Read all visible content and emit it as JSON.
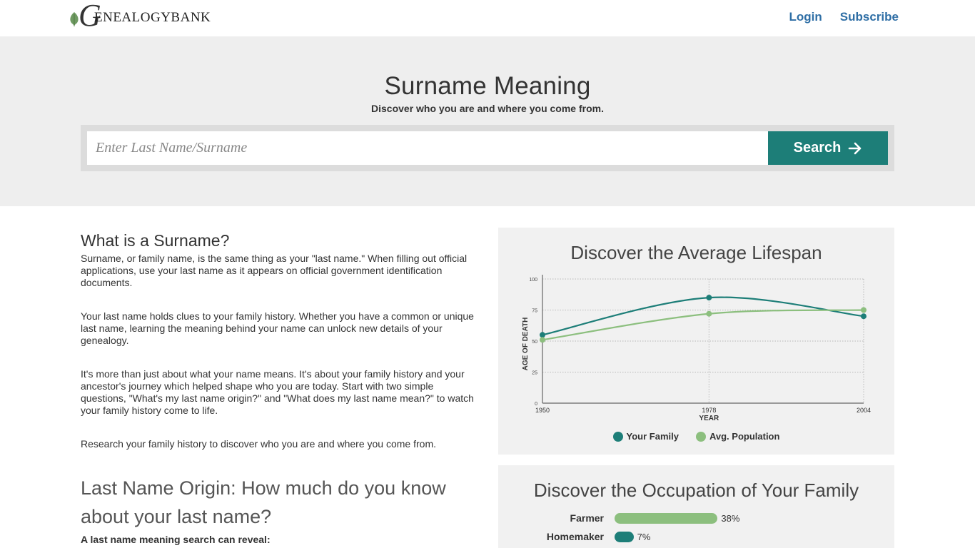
{
  "header": {
    "logo_text": "ENEALOGYBANK",
    "logo_letter": "G",
    "login": "Login",
    "subscribe": "Subscribe"
  },
  "hero": {
    "title": "Surname Meaning",
    "subtitle": "Discover who you are and where you come from.",
    "search_placeholder": "Enter Last Name/Surname",
    "search_value": "",
    "search_button": "Search"
  },
  "content": {
    "what_title": "What is a Surname?",
    "paragraphs": [
      "Surname, or family name, is the same thing as your \"last name.\" When filling out official applications, use your last name as it appears on official government identification documents.",
      "Your last name holds clues to your family history. Whether you have a common or unique last name, learning the meaning behind your name can unlock new details of your genealogy.",
      "It's more than just about what your name means. It's about your family history and your ancestor's journey which helped shape who you are today. Start with two simple questions, \"What's my last name origin?\" and \"What does my last name mean?\" to watch your family history come to life.",
      "Research your family history to discover who you are and where you come from."
    ],
    "origin_title": "Last Name Origin: How much do you know about your last name?",
    "reveal_text": "A last name meaning search can reveal:"
  },
  "lifespan": {
    "title": "Discover the Average Lifespan"
  },
  "chart_data": {
    "type": "line",
    "title": "Discover the Average Lifespan",
    "xlabel": "YEAR",
    "ylabel": "AGE OF DEATH",
    "x": [
      1950,
      1978,
      2004
    ],
    "x_ticks": [
      "1950",
      "1978",
      "2004"
    ],
    "y_ticks": [
      "0",
      "25",
      "50",
      "75",
      "100"
    ],
    "ylim": [
      0,
      100
    ],
    "grid": true,
    "legend": "bottom",
    "series": [
      {
        "name": "Your Family",
        "color": "#1d7e78",
        "values": [
          55,
          85,
          70
        ]
      },
      {
        "name": "Avg. Population",
        "color": "#8cbf7e",
        "values": [
          51,
          72,
          75
        ]
      }
    ]
  },
  "occupation": {
    "title": "Discover the Occupation of Your Family",
    "items": [
      {
        "label": "Farmer",
        "percent": 38,
        "value_text": "38%",
        "color": "#8cbf7e"
      },
      {
        "label": "Homemaker",
        "percent": 7,
        "value_text": "7%",
        "color": "#1d7e78"
      }
    ]
  }
}
